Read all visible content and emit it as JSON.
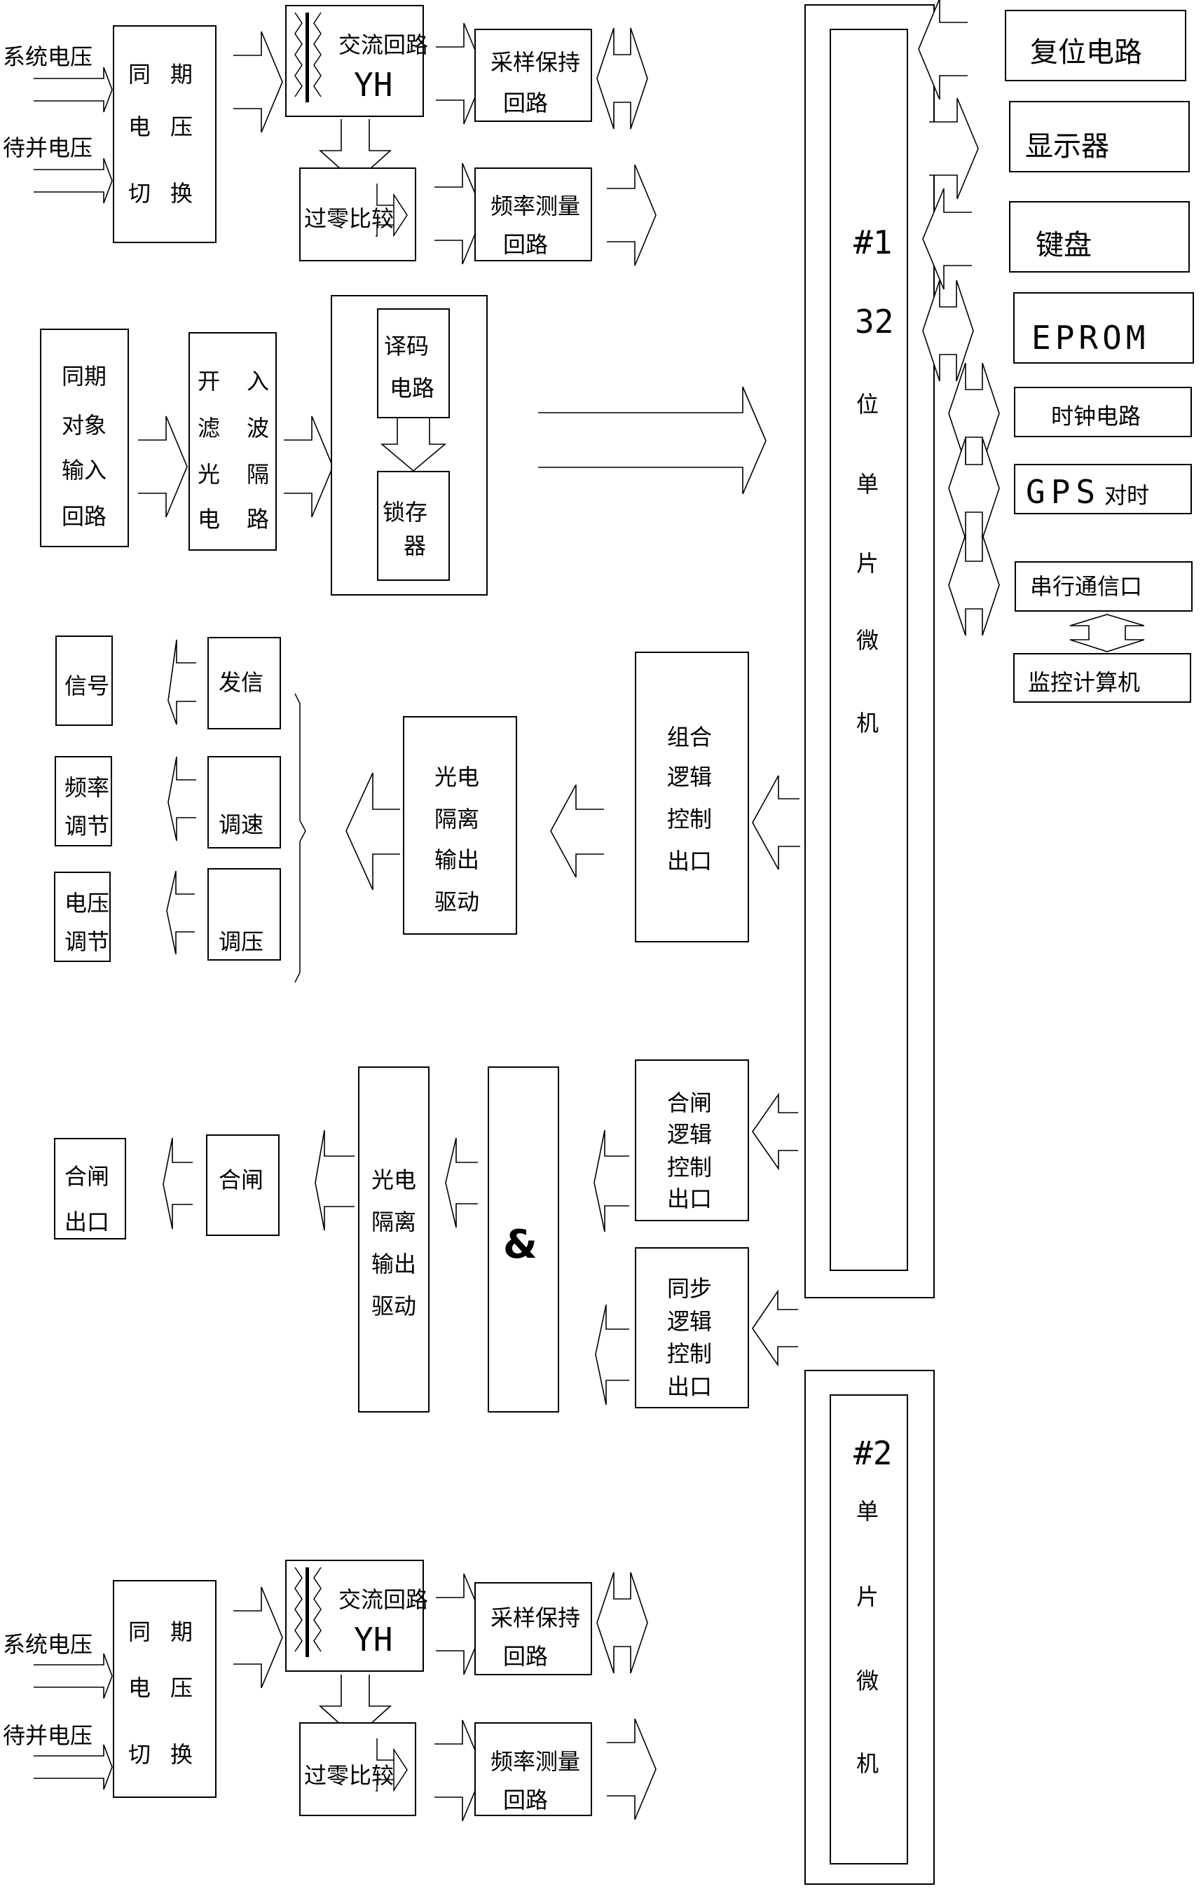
{
  "diagram": {
    "title": "",
    "top_section": {
      "input_system_voltage": "系统电压",
      "input_pending_voltage": "待并电压",
      "sync_switch": [
        "同",
        "期",
        "电",
        "压",
        "切",
        "换"
      ],
      "ac_circuit": "交流回路",
      "ac_circuit_sub": "YH",
      "zero_cross": "过零比较",
      "sample_hold": [
        "采样保持",
        "回路"
      ],
      "freq_measure": [
        "频率测量",
        "回路"
      ]
    },
    "input_section": {
      "sync_object_input": [
        "同期",
        "对象",
        "输入",
        "回路"
      ],
      "opto_filter": [
        "开",
        "入",
        "滤",
        "波",
        "光",
        "隔",
        "电",
        "路"
      ],
      "decoder": [
        "译码",
        "电路"
      ],
      "latch": [
        "锁存",
        "器"
      ]
    },
    "mcu1": {
      "label_id": "#1",
      "label_bits": "32",
      "label_chars": [
        "位",
        "单",
        "片",
        "微",
        "机"
      ]
    },
    "peripherals": [
      {
        "label": "复位电路",
        "direction": "in"
      },
      {
        "label": "显示器",
        "direction": "out"
      },
      {
        "label": "键盘",
        "direction": "in"
      },
      {
        "label": "EPROM",
        "direction": "bidirectional"
      },
      {
        "label": "时钟电路",
        "direction": "bidirectional"
      },
      {
        "label": "GPS对时",
        "direction": "bidirectional",
        "latin": "GPS",
        "cjk": "对时"
      },
      {
        "label": "串行通信口",
        "direction": "bidirectional"
      }
    ],
    "monitor_computer": "监控计算机",
    "output_section": {
      "combo_logic": [
        "组合",
        "逻辑",
        "控制",
        "出口"
      ],
      "opto_output_1": [
        "光电",
        "隔离",
        "输出",
        "驱动"
      ],
      "relays": [
        "发信",
        "调速",
        "调压"
      ],
      "targets": [
        [
          "信号"
        ],
        [
          "频率",
          "调节"
        ],
        [
          "电压",
          "调节"
        ]
      ]
    },
    "close_section": {
      "close_logic": [
        "合闸",
        "逻辑",
        "控制",
        "出口"
      ],
      "sync_logic": [
        "同步",
        "逻辑",
        "控制",
        "出口"
      ],
      "and_gate": "&",
      "opto_output_2": [
        "光电",
        "隔离",
        "输出",
        "驱动"
      ],
      "close_relay": "合闸",
      "close_outlet": [
        "合闸",
        "出口"
      ]
    },
    "mcu2": {
      "label_id": "#2",
      "label_chars": [
        "单",
        "片",
        "微",
        "机"
      ]
    },
    "bottom_section": {
      "input_system_voltage": "系统电压",
      "input_pending_voltage": "待并电压",
      "sync_switch": [
        "同",
        "期",
        "电",
        "压",
        "切",
        "换"
      ],
      "ac_circuit": "交流回路",
      "ac_circuit_sub": "YH",
      "zero_cross": "过零比较",
      "sample_hold": [
        "采样保持",
        "回路"
      ],
      "freq_measure": [
        "频率测量",
        "回路"
      ]
    }
  }
}
